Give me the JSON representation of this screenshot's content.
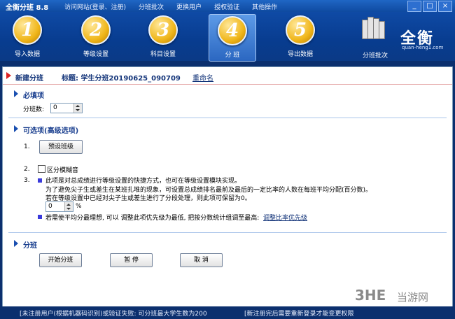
{
  "window": {
    "title": "全衡分班 8.8",
    "menu": [
      "访问网站(登录、注册)",
      "分班批次",
      "更换用户",
      "授权验证",
      "其他操作"
    ],
    "controls": [
      "_",
      "□",
      "×"
    ]
  },
  "toolbar": {
    "buttons": [
      {
        "num": "1",
        "label": "导入数据"
      },
      {
        "num": "2",
        "label": "等级设置"
      },
      {
        "num": "3",
        "label": "科目设置"
      },
      {
        "num": "4",
        "label": "分  班"
      },
      {
        "num": "5",
        "label": "导出数据"
      }
    ],
    "batch_label": "分班批次",
    "logo": "全衡",
    "logo_url": "quan-heng1.com"
  },
  "header": {
    "new_label": "新建分班",
    "title_prefix": "标题: 学生分班20190625_090709",
    "rename": "重命名"
  },
  "required": {
    "title": "必填项",
    "class_count_label": "分班数:",
    "class_count_value": "0"
  },
  "optional": {
    "title": "可选项(高级选项)",
    "item1_num": "1.",
    "preset_button": "预设班级",
    "item2_num": "2.",
    "fuzzy_label": "区分模糊音",
    "item3_num": "3.",
    "desc_line1": "此项是对总成绩进行等级设置的快捷方式，也可在等级设置模块实现。",
    "desc_line2": "为了避免尖子生或差生在某班扎堆的现象，可设置总成绩排名最前及最后的一定比率的人数在每班平均分配(百分数)。",
    "desc_line3": "若在等级设置中已经对尖子生或差生进行了分段处理，则此项可保留为0。",
    "percent_value": "0",
    "percent_unit": "%",
    "tip": "若需使平均分最理想, 可以 调整此项优先级为最低, 把按分数统计组调至最高:",
    "adjust_link": "调整比率优先级"
  },
  "divide": {
    "title": "分班",
    "start_button": "开始分班",
    "pause_button": "暂  停",
    "cancel_button": "取  消"
  },
  "status": {
    "left": "[未注册用户(根据机器码识别)或验证失败: 可分班最大学生数为200",
    "right": "[新注册完后需要重新登录才能变更权限"
  },
  "watermark": {
    "brand": "3HE",
    "site": "当游网"
  }
}
